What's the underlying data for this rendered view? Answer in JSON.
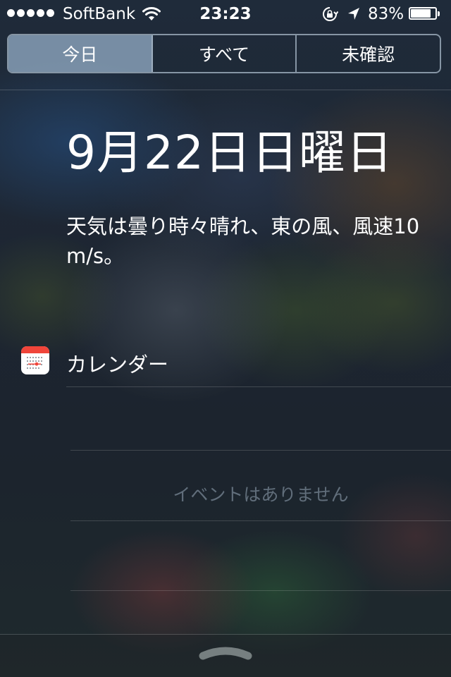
{
  "status_bar": {
    "carrier": "SoftBank",
    "time": "23:23",
    "battery_percent": "83%",
    "battery_level": 0.83,
    "signal_bars": 5
  },
  "tabs": [
    {
      "label": "今日",
      "selected": true
    },
    {
      "label": "すべて",
      "selected": false
    },
    {
      "label": "未確認",
      "selected": false
    }
  ],
  "today": {
    "date": "9月22日日曜日",
    "weather": "天気は曇り時々晴れ、東の風、風速10 m/s。"
  },
  "calendar": {
    "title": "カレンダー",
    "empty_text": "イベントはありません"
  },
  "icons": {
    "wifi": "wifi-icon",
    "rotation_lock": "rotation-lock-icon",
    "location": "location-arrow-icon",
    "battery": "battery-icon",
    "calendar": "calendar-icon",
    "grabber": "chevron-up-icon"
  },
  "colors": {
    "selected_tab": "#96afc8",
    "calendar_red": "#f0453a",
    "empty_text": "#78879a"
  }
}
